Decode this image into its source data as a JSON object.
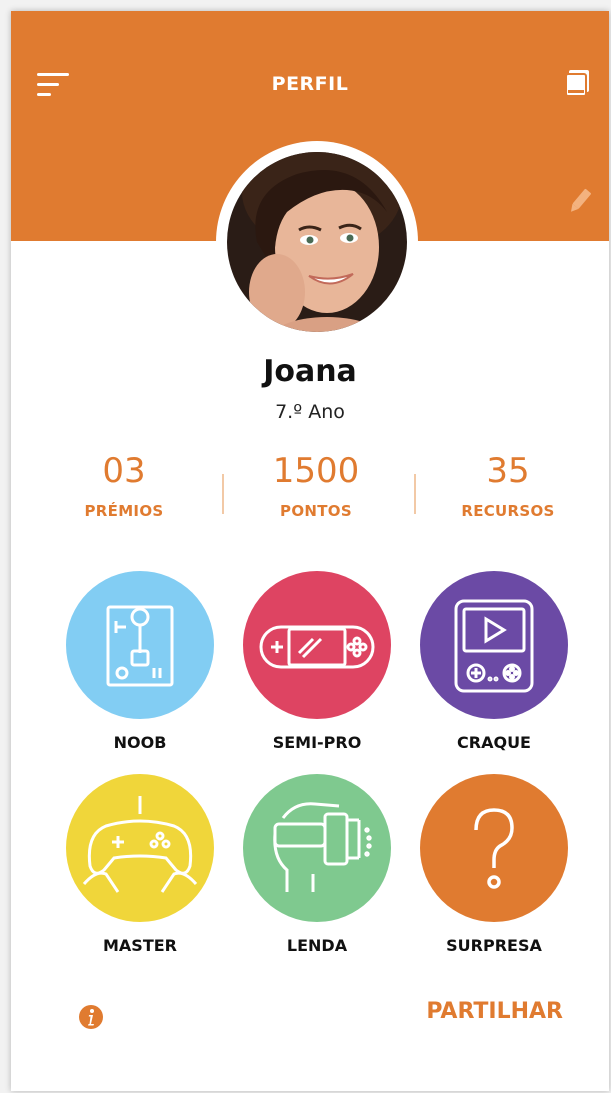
{
  "colors": {
    "accent": "#e07b30",
    "noob": "#82cdf3",
    "semi_pro": "#de4462",
    "craque": "#6b4aa5",
    "master": "#f0d63a",
    "lenda": "#7fc98f",
    "surpresa": "#e07b30"
  },
  "header": {
    "title": "PERFIL",
    "menu_icon": "menu-icon",
    "book_icon": "book-icon",
    "edit_icon": "pencil-icon"
  },
  "profile": {
    "name": "Joana",
    "grade": "7.º Ano"
  },
  "stats": [
    {
      "value": "03",
      "label": "PRÉMIOS"
    },
    {
      "value": "1500",
      "label": "PONTOS"
    },
    {
      "value": "35",
      "label": "RECURSOS"
    }
  ],
  "badges": [
    {
      "label": "NOOB",
      "icon": "joystick-icon"
    },
    {
      "label": "SEMI-PRO",
      "icon": "handheld-console-icon"
    },
    {
      "label": "CRAQUE",
      "icon": "gameboy-icon"
    },
    {
      "label": "MASTER",
      "icon": "gamepad-icon"
    },
    {
      "label": "LENDA",
      "icon": "vr-headset-icon"
    },
    {
      "label": "SURPRESA",
      "icon": "question-mark-icon"
    }
  ],
  "footer": {
    "info_icon": "info-icon",
    "share_label": "PARTILHAR"
  }
}
